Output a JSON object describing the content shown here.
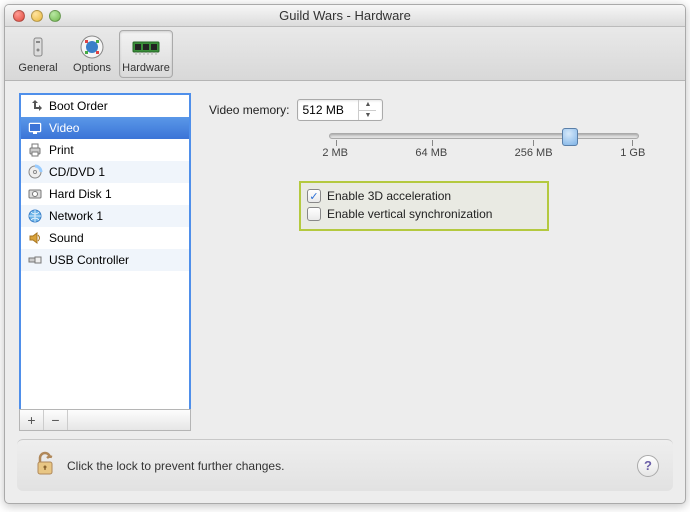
{
  "window": {
    "title": "Guild Wars - Hardware"
  },
  "toolbar": {
    "items": [
      {
        "label": "General",
        "icon": "general-icon",
        "selected": false
      },
      {
        "label": "Options",
        "icon": "options-icon",
        "selected": false
      },
      {
        "label": "Hardware",
        "icon": "hardware-icon",
        "selected": true
      }
    ]
  },
  "sidebar": {
    "items": [
      {
        "label": "Boot Order",
        "icon": "boot-order-icon",
        "selected": false
      },
      {
        "label": "Video",
        "icon": "video-icon",
        "selected": true
      },
      {
        "label": "Print",
        "icon": "print-icon",
        "selected": false
      },
      {
        "label": "CD/DVD 1",
        "icon": "cd-dvd-icon",
        "selected": false
      },
      {
        "label": "Hard Disk 1",
        "icon": "hard-disk-icon",
        "selected": false
      },
      {
        "label": "Network 1",
        "icon": "network-icon",
        "selected": false
      },
      {
        "label": "Sound",
        "icon": "sound-icon",
        "selected": false
      },
      {
        "label": "USB Controller",
        "icon": "usb-icon",
        "selected": false
      }
    ],
    "add": "+",
    "remove": "−"
  },
  "main": {
    "video_memory_label": "Video memory:",
    "video_memory_value": "512 MB",
    "slider": {
      "min_label": "2 MB",
      "ticks": [
        "2 MB",
        "64 MB",
        "256 MB",
        "1 GB"
      ],
      "positions_pct": [
        2,
        33,
        66,
        98
      ],
      "thumb_pct": 78
    },
    "checkbox1": {
      "label": "Enable 3D acceleration",
      "checked": true
    },
    "checkbox2": {
      "label": "Enable vertical synchronization",
      "checked": false
    }
  },
  "footer": {
    "lock_text": "Click the lock to prevent further changes.",
    "help": "?"
  }
}
